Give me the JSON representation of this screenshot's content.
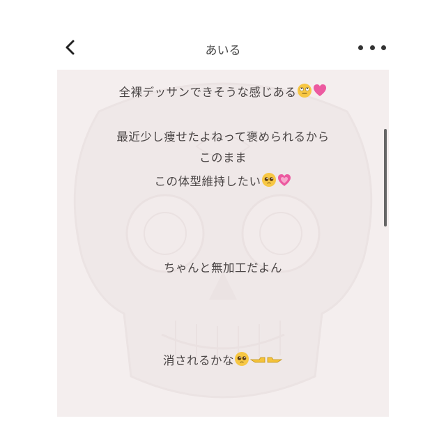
{
  "header": {
    "title": "あいる",
    "back_icon": "chevron-left-icon",
    "more_icon": "more-dots-icon"
  },
  "post": {
    "line1": "全裸デッサンできそうな感じある",
    "line2": "最近少し痩せたよねって褒められるから",
    "line3": "このまま",
    "line4": "この体型維持したい",
    "line5": "ちゃんと無加工だよん",
    "line6": "消されるかな"
  },
  "icons": {
    "rolling_eyes": "rolling-eyes-emoji",
    "pink_heart": "pink-heart-emoji",
    "pleading_face": "pleading-face-emoji",
    "growing_heart": "growing-heart-emoji",
    "pointing_fingers": "pointing-fingers-emoji"
  },
  "colors": {
    "background": "#f4eeee",
    "text": "#4a4545",
    "pink": "#ec5aa0"
  }
}
